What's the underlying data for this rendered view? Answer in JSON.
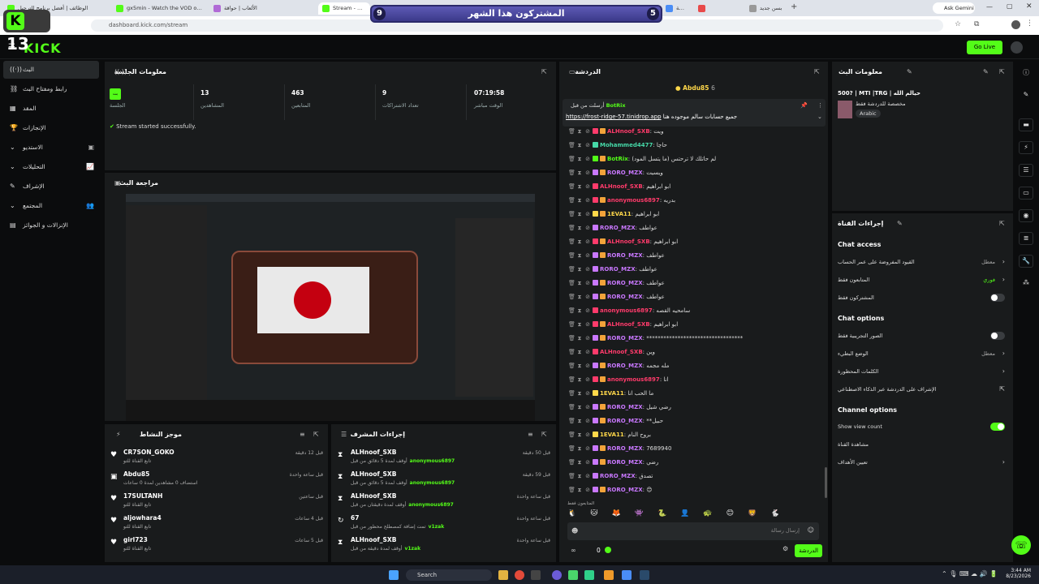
{
  "browser": {
    "tabs": [
      {
        "label": "الوظائف | أفضل برنامج للترحيل",
        "color": "#53fc18"
      },
      {
        "label": "gx5min - Watch the VOD on Kick",
        "color": "#53fc18"
      },
      {
        "label": "الألعاب | حواقة",
        "color": "#b06ad6"
      },
      {
        "label": "Stream - Kick Dashboard",
        "color": "#53fc18"
      },
      {
        "label": "شريحة",
        "color": "#4a8df6"
      },
      {
        "label": "",
        "color": "#e84a4a"
      },
      {
        "label": "بسن جديد",
        "color": "#999"
      }
    ],
    "url": "dashboard.kick.com/stream",
    "gemini": "Ask Gemini"
  },
  "overlay": {
    "k13": "13",
    "sub_title": "المشتركون هذا الشهر",
    "sub_left": "9",
    "sub_right": "5"
  },
  "header": {
    "logo": "KICK",
    "go_live": "Go Live"
  },
  "sidebar": {
    "items": [
      {
        "label": "البث",
        "active": true,
        "icon": "broadcast-icon"
      },
      {
        "label": "رابط ومفتاح البث",
        "icon": "link-icon"
      },
      {
        "label": "المقد",
        "icon": "grid-icon"
      },
      {
        "label": "الإنجازات",
        "icon": "trophy-icon"
      },
      {
        "label": "الاستديو",
        "icon": "studio-icon"
      },
      {
        "label": "التحليلات",
        "icon": "chart-icon"
      },
      {
        "label": "الإشراف",
        "icon": "shield-icon"
      },
      {
        "label": "المجتمع",
        "icon": "community-icon"
      },
      {
        "label": "الإنزالات و الجوائز",
        "icon": "gift-icon"
      }
    ]
  },
  "session": {
    "title": "معلومات الجلسة",
    "live_label": "الجلسة",
    "stats": [
      {
        "value": "13",
        "label": "المشاهدين"
      },
      {
        "value": "463",
        "label": "المتابعين"
      },
      {
        "value": "9",
        "label": "تعداد الاشتراكات"
      },
      {
        "value": "07:19:58",
        "label": "الوقت مباشر"
      }
    ],
    "status": "Stream started successfully."
  },
  "preview": {
    "title": "مراجعة البث"
  },
  "activity": {
    "title": "موجز النشاط",
    "items": [
      {
        "name": "CR7SON_GOKO",
        "sub": "تابع القناة للتو",
        "time": "قبل 12 دقيقة"
      },
      {
        "name": "Abdu85",
        "sub": "استضاف 0 مشاهدين لمدة 0 ساعات",
        "time": "قبل ساعة واحدة"
      },
      {
        "name": "17SULTANH",
        "sub": "تابع القناة للتو",
        "time": "قبل ساعتين"
      },
      {
        "name": "aljowhara4",
        "sub": "تابع القناة للتو",
        "time": "قبل 4 ساعات"
      },
      {
        "name": "girl723",
        "sub": "تابع القناة للتو",
        "time": "قبل 5 ساعات"
      }
    ]
  },
  "modlog": {
    "title": "إجراءات المشرف",
    "items": [
      {
        "name": "ALHnoof_SXB",
        "sub": "أوقف لمدة 5 دقائق من قبل",
        "target": "anonymous6897",
        "time": "قبل 50 دقيقة"
      },
      {
        "name": "ALHnoof_SXB",
        "sub": "أوقف لمدة 5 دقائق من قبل",
        "target": "anonymous6897",
        "time": "قبل 59 دقيقة"
      },
      {
        "name": "ALHnoof_SXB",
        "sub": "أوقف لمدة دقيقتان من قبل",
        "target": "anonymous6897",
        "time": "قبل ساعة واحدة"
      },
      {
        "name": "67",
        "sub": "تمت إضافة كمصطلح محظور من قبل",
        "target": "v1zak",
        "time": "قبل ساعة واحدة"
      },
      {
        "name": "ALHnoof_SXB",
        "sub": "أوقف لمدة دقيقة من قبل",
        "target": "v1zak",
        "time": "قبل ساعة واحدة"
      }
    ]
  },
  "chat": {
    "title": "الدردشة",
    "host": "Abdu85",
    "host_count": "6",
    "pinned_header": "أرسلت من قبل",
    "pinned_user": "BotRix",
    "pinned_link": "https://frost-ridge-57.tinidrop.app",
    "pinned_text": "جميع حسابات سالم موجوده هنا",
    "messages": [
      {
        "user": "ALHnoof_SXB",
        "color": "#ff3b6b",
        "text": "ويت"
      },
      {
        "user": "Mohammed4477",
        "color": "#46d9a8",
        "text": "حاچا"
      },
      {
        "user": "BotRix",
        "color": "#53fc18",
        "text": "لم حاتلك لا ترحتس (ما يتسل المود)"
      },
      {
        "user": "RORO_MZX",
        "color": "#c978ff",
        "text": "ويسيت"
      },
      {
        "user": "ALHnoof_SXB",
        "color": "#ff3b6b",
        "text": "ابو ابراهيم"
      },
      {
        "user": "anonymous6897",
        "color": "#ff3b6b",
        "text": "بدريه"
      },
      {
        "user": "1EVA11",
        "color": "#ffd84a",
        "text": "ابو ابراهيم"
      },
      {
        "user": "RORO_MZX",
        "color": "#c978ff",
        "text": "عواطف"
      },
      {
        "user": "ALHnoof_SXB",
        "color": "#ff3b6b",
        "text": "ابو ابراهيم"
      },
      {
        "user": "RORO_MZX",
        "color": "#c978ff",
        "text": "عواطف"
      },
      {
        "user": "RORO_MZX",
        "color": "#c978ff",
        "text": "عواطف"
      },
      {
        "user": "RORO_MZX",
        "color": "#c978ff",
        "text": "عواطف"
      },
      {
        "user": "RORO_MZX",
        "color": "#c978ff",
        "text": "عواطف"
      },
      {
        "user": "anonymous6897",
        "color": "#ff3b6b",
        "text": "سامحيه القصه"
      },
      {
        "user": "ALHnoof_SXB",
        "color": "#ff3b6b",
        "text": "ابو ابراهيم"
      },
      {
        "user": "RORO_MZX",
        "color": "#c978ff",
        "text": "**********************************"
      },
      {
        "user": "ALHnoof_SXB",
        "color": "#ff3b6b",
        "text": "وين"
      },
      {
        "user": "RORO_MZX",
        "color": "#c978ff",
        "text": "مله مجمه"
      },
      {
        "user": "anonymous6897",
        "color": "#ff3b6b",
        "text": "انا"
      },
      {
        "user": "1EVA11",
        "color": "#ffd84a",
        "text": "ما الحب انا"
      },
      {
        "user": "RORO_MZX",
        "color": "#c978ff",
        "text": "رضي شيل"
      },
      {
        "user": "RORO_MZX",
        "color": "#c978ff",
        "text": "**حبيل"
      },
      {
        "user": "1EVA11",
        "color": "#ffd84a",
        "text": "بروح النام"
      },
      {
        "user": "RORO_MZX",
        "color": "#c978ff",
        "text": "7689940"
      },
      {
        "user": "RORO_MZX",
        "color": "#c978ff",
        "text": "رضي"
      },
      {
        "user": "RORO_MZX",
        "color": "#c978ff",
        "text": "تصدق"
      },
      {
        "user": "RORO_MZX",
        "color": "#c978ff",
        "text": "😊"
      }
    ],
    "followers_only": "المتابعون فقط",
    "input_placeholder": "إرسال رسالة",
    "points": "0",
    "send": "الدردشة"
  },
  "stream_info": {
    "title": "معلومات البث",
    "stream_title": "500? | MTI |TRG | حيالم الله",
    "category": "مخصصة للدردشة فقط",
    "tag": "Arabic"
  },
  "channel_settings": {
    "title": "إجراءات القناة",
    "chat_access": "Chat access",
    "access_rows": [
      {
        "label": "القيود المفروضة على عمر الحساب",
        "value": "معطل"
      },
      {
        "label": "المتابعون فقط",
        "value": "فوري"
      },
      {
        "label": "المشتركون فقط",
        "value": ""
      }
    ],
    "chat_options": "Chat options",
    "option_rows": [
      {
        "label": "الصور التجريبية فقط",
        "value": ""
      },
      {
        "label": "الوضع البطيء",
        "value": "معطل"
      },
      {
        "label": "الكلمات المحظورة",
        "value": ""
      },
      {
        "label": "الإشراف على الدردشة عبر الذكاء الاصطناعي",
        "value": ""
      }
    ],
    "channel_options": "Channel options",
    "channel_rows": [
      {
        "label": "Show view count",
        "value": ""
      },
      {
        "label": "مشاهدة القناة",
        "value": ""
      },
      {
        "label": "تعيين الأهداف",
        "value": ""
      }
    ]
  },
  "taskbar": {
    "search": "Search",
    "time": "3:44 AM",
    "date": "8/23/2026"
  }
}
